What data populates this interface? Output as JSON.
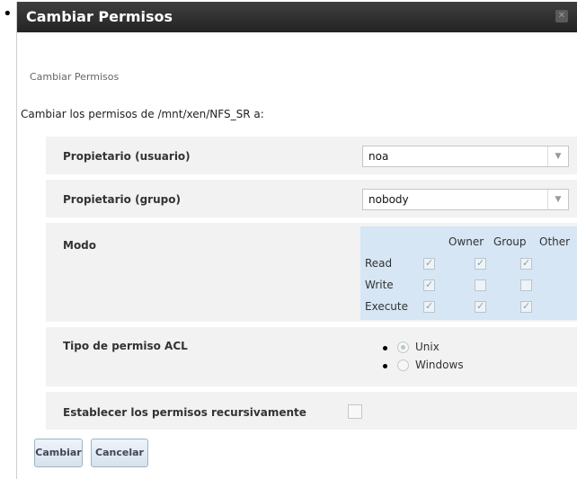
{
  "bullet": "•",
  "dialog": {
    "title": "Cambiar Permisos",
    "subtitle": "Cambiar Permisos",
    "intro": "Cambiar los permisos de /mnt/xen/NFS_SR a:"
  },
  "fields": {
    "owner_user_label": "Propietario (usuario)",
    "owner_user_value": "noa",
    "owner_group_label": "Propietario (grupo)",
    "owner_group_value": "nobody",
    "mode_label": "Modo",
    "acl_label": "Tipo de permiso ACL",
    "recursive_label": "Establecer los permisos recursivamente"
  },
  "mode": {
    "columns": [
      "Owner",
      "Group",
      "Other"
    ],
    "rows": [
      {
        "label": "Read",
        "checked": [
          true,
          true,
          true
        ]
      },
      {
        "label": "Write",
        "checked": [
          true,
          false,
          false
        ]
      },
      {
        "label": "Execute",
        "checked": [
          true,
          true,
          true
        ]
      }
    ]
  },
  "acl": {
    "options": [
      {
        "label": "Unix",
        "selected": true
      },
      {
        "label": "Windows",
        "selected": false
      }
    ]
  },
  "buttons": {
    "apply": "Cambiar",
    "cancel": "Cancelar"
  },
  "icons": {
    "close": "close-icon",
    "dropdown": "chevron-down-icon"
  },
  "colors": {
    "titlebar": "#2e2e2e",
    "mode_panel": "#d6e6f4",
    "row_bg": "#f2f2f2"
  }
}
